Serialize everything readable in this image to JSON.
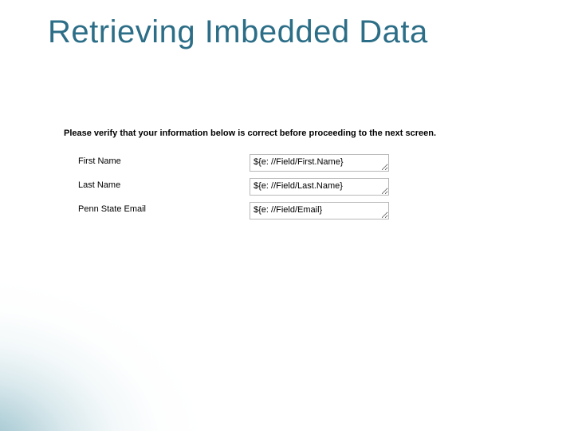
{
  "slide": {
    "title": "Retrieving Imbedded Data"
  },
  "form": {
    "instruction": "Please verify that your information below is correct before proceeding to the next screen.",
    "rows": [
      {
        "label": "First Name",
        "value": "${e: //Field/First.Name}"
      },
      {
        "label": "Last Name",
        "value": "${e: //Field/Last.Name}"
      },
      {
        "label": "Penn State Email",
        "value": "${e: //Field/Email}"
      }
    ]
  }
}
